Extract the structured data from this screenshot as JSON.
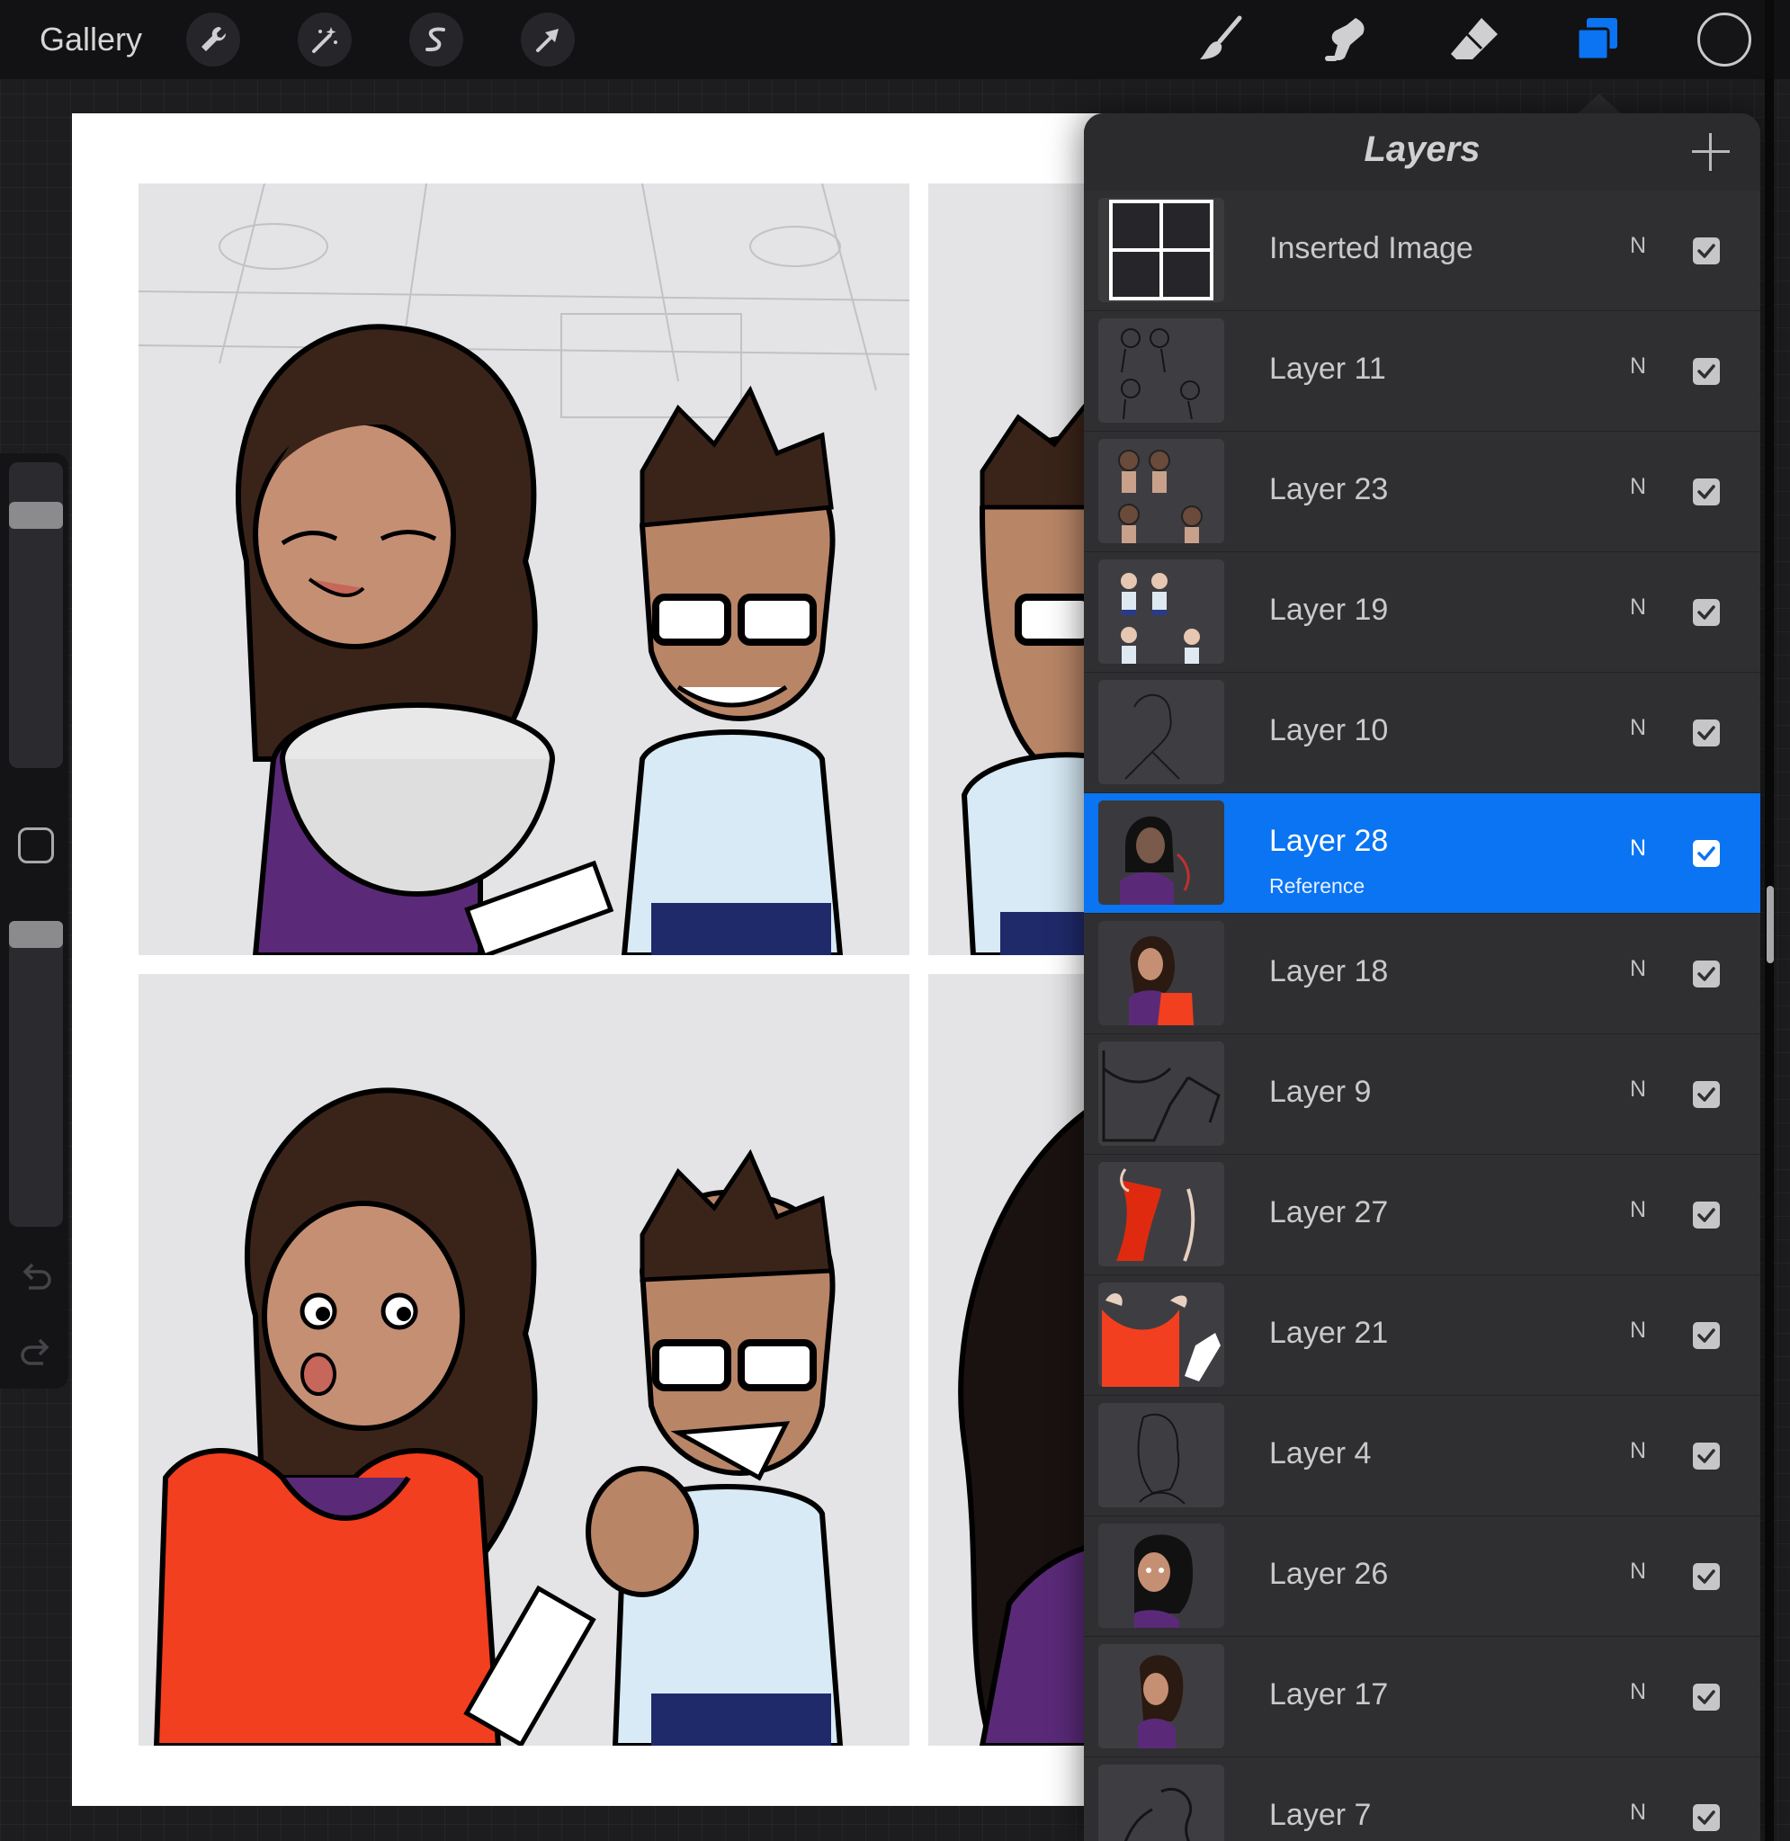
{
  "toolbar": {
    "gallery_label": "Gallery",
    "left_tools": [
      "wrench-icon",
      "magic-wand-icon",
      "selection-icon",
      "transform-arrow-icon"
    ],
    "right_tools": [
      "brush-icon",
      "smudge-icon",
      "eraser-icon",
      "layers-icon"
    ],
    "active_tool": "layers-icon",
    "current_color": "#151517",
    "accent_color": "#0a74f2"
  },
  "sidebar": {
    "icons": [
      "brush-size-slider",
      "modify-button",
      "opacity-slider",
      "undo-icon",
      "redo-icon"
    ]
  },
  "layers": {
    "title": "Layers",
    "add_icon": "plus-icon",
    "items": [
      {
        "name": "Inserted Image",
        "blend": "N",
        "visible": true,
        "selected": false,
        "sub": ""
      },
      {
        "name": "Layer 11",
        "blend": "N",
        "visible": true,
        "selected": false,
        "sub": ""
      },
      {
        "name": "Layer 23",
        "blend": "N",
        "visible": true,
        "selected": false,
        "sub": ""
      },
      {
        "name": "Layer 19",
        "blend": "N",
        "visible": true,
        "selected": false,
        "sub": ""
      },
      {
        "name": "Layer 10",
        "blend": "N",
        "visible": true,
        "selected": false,
        "sub": ""
      },
      {
        "name": "Layer 28",
        "blend": "N",
        "visible": true,
        "selected": true,
        "sub": "Reference"
      },
      {
        "name": "Layer 18",
        "blend": "N",
        "visible": true,
        "selected": false,
        "sub": ""
      },
      {
        "name": "Layer 9",
        "blend": "N",
        "visible": true,
        "selected": false,
        "sub": ""
      },
      {
        "name": "Layer 27",
        "blend": "N",
        "visible": true,
        "selected": false,
        "sub": ""
      },
      {
        "name": "Layer 21",
        "blend": "N",
        "visible": true,
        "selected": false,
        "sub": ""
      },
      {
        "name": "Layer 4",
        "blend": "N",
        "visible": true,
        "selected": false,
        "sub": ""
      },
      {
        "name": "Layer 26",
        "blend": "N",
        "visible": true,
        "selected": false,
        "sub": ""
      },
      {
        "name": "Layer 17",
        "blend": "N",
        "visible": true,
        "selected": false,
        "sub": ""
      },
      {
        "name": "Layer 7",
        "blend": "N",
        "visible": true,
        "selected": false,
        "sub": ""
      }
    ]
  }
}
